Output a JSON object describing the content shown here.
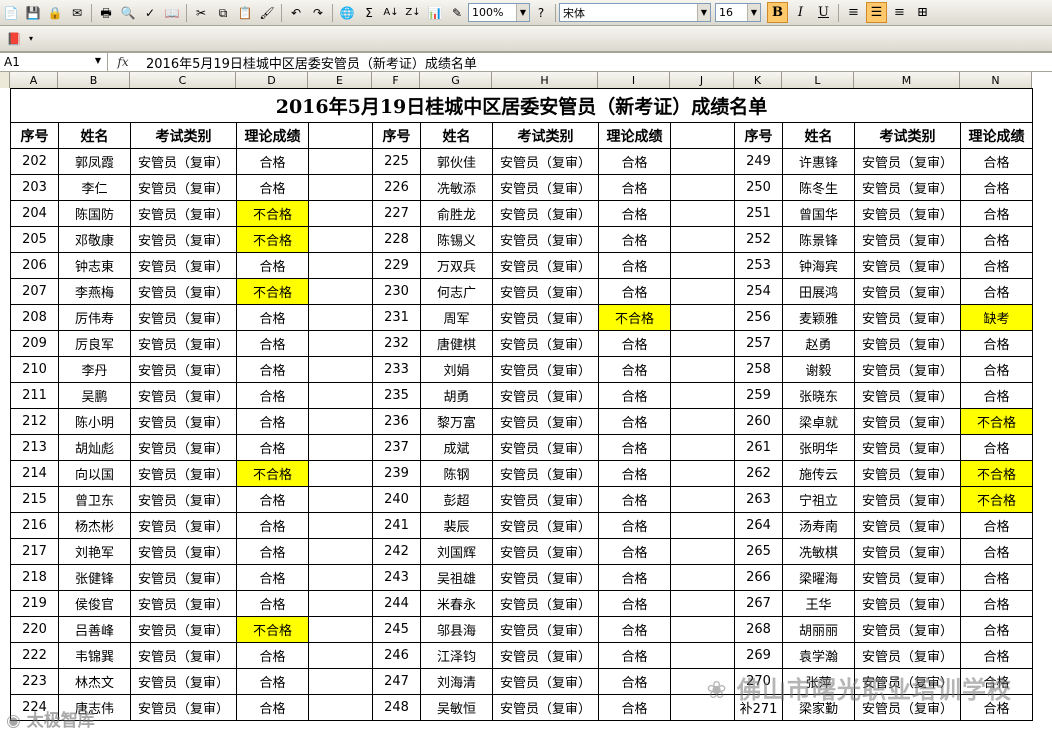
{
  "toolbar": {
    "zoom": "100%",
    "font": "宋体",
    "font_size": "16",
    "bold": "B",
    "italic": "I",
    "underline": "U",
    "sum": "Σ",
    "sort_asc": "A↓",
    "sort_desc": "Z↓"
  },
  "formula_bar": {
    "name_box": "A1",
    "fx": "fx",
    "content": "2016年5月19日桂城中区居委安管员（新考证）成绩名单"
  },
  "columns": [
    "A",
    "B",
    "C",
    "D",
    "E",
    "F",
    "G",
    "H",
    "I",
    "J",
    "K",
    "L",
    "M",
    "N"
  ],
  "sheet": {
    "title": "2016年5月19日桂城中区居委安管员（新考证）成绩名单",
    "headers": [
      "序号",
      "姓名",
      "考试类别",
      "理论成绩"
    ],
    "category": "安管员（复审）",
    "rows": [
      [
        [
          "202",
          "郭凤霞",
          "合格"
        ],
        [
          "225",
          "郭伙佳",
          "合格"
        ],
        [
          "249",
          "许惠锋",
          "合格"
        ]
      ],
      [
        [
          "203",
          "李仁",
          "合格"
        ],
        [
          "226",
          "冼敏添",
          "合格"
        ],
        [
          "250",
          "陈冬生",
          "合格"
        ]
      ],
      [
        [
          "204",
          "陈国防",
          "不合格"
        ],
        [
          "227",
          "俞胜龙",
          "合格"
        ],
        [
          "251",
          "曾国华",
          "合格"
        ]
      ],
      [
        [
          "205",
          "邓敬康",
          "不合格"
        ],
        [
          "228",
          "陈锡义",
          "合格"
        ],
        [
          "252",
          "陈景锋",
          "合格"
        ]
      ],
      [
        [
          "206",
          "钟志東",
          "合格"
        ],
        [
          "229",
          "万双兵",
          "合格"
        ],
        [
          "253",
          "钟海宾",
          "合格"
        ]
      ],
      [
        [
          "207",
          "李燕梅",
          "不合格"
        ],
        [
          "230",
          "何志广",
          "合格"
        ],
        [
          "254",
          "田展鸿",
          "合格"
        ]
      ],
      [
        [
          "208",
          "厉伟寿",
          "合格"
        ],
        [
          "231",
          "周军",
          "不合格"
        ],
        [
          "256",
          "麦颖雅",
          "缺考"
        ]
      ],
      [
        [
          "209",
          "厉良军",
          "合格"
        ],
        [
          "232",
          "唐健棋",
          "合格"
        ],
        [
          "257",
          "赵勇",
          "合格"
        ]
      ],
      [
        [
          "210",
          "李丹",
          "合格"
        ],
        [
          "233",
          "刘娟",
          "合格"
        ],
        [
          "258",
          "谢毅",
          "合格"
        ]
      ],
      [
        [
          "211",
          "吴鹏",
          "合格"
        ],
        [
          "235",
          "胡勇",
          "合格"
        ],
        [
          "259",
          "张晓东",
          "合格"
        ]
      ],
      [
        [
          "212",
          "陈小明",
          "合格"
        ],
        [
          "236",
          "黎万富",
          "合格"
        ],
        [
          "260",
          "梁卓就",
          "不合格"
        ]
      ],
      [
        [
          "213",
          "胡灿彪",
          "合格"
        ],
        [
          "237",
          "成斌",
          "合格"
        ],
        [
          "261",
          "张明华",
          "合格"
        ]
      ],
      [
        [
          "214",
          "向以国",
          "不合格"
        ],
        [
          "239",
          "陈钢",
          "合格"
        ],
        [
          "262",
          "施传云",
          "不合格"
        ]
      ],
      [
        [
          "215",
          "曾卫东",
          "合格"
        ],
        [
          "240",
          "彭超",
          "合格"
        ],
        [
          "263",
          "宁祖立",
          "不合格"
        ]
      ],
      [
        [
          "216",
          "杨杰彬",
          "合格"
        ],
        [
          "241",
          "裴辰",
          "合格"
        ],
        [
          "264",
          "汤寿南",
          "合格"
        ]
      ],
      [
        [
          "217",
          "刘艳军",
          "合格"
        ],
        [
          "242",
          "刘国辉",
          "合格"
        ],
        [
          "265",
          "冼敏棋",
          "合格"
        ]
      ],
      [
        [
          "218",
          "张健锋",
          "合格"
        ],
        [
          "243",
          "吴祖雄",
          "合格"
        ],
        [
          "266",
          "梁曜海",
          "合格"
        ]
      ],
      [
        [
          "219",
          "侯俊官",
          "合格"
        ],
        [
          "244",
          "米春永",
          "合格"
        ],
        [
          "267",
          "王华",
          "合格"
        ]
      ],
      [
        [
          "220",
          "吕善峰",
          "不合格"
        ],
        [
          "245",
          "邬县海",
          "合格"
        ],
        [
          "268",
          "胡丽丽",
          "合格"
        ]
      ],
      [
        [
          "222",
          "韦锦巽",
          "合格"
        ],
        [
          "246",
          "江泽钧",
          "合格"
        ],
        [
          "269",
          "袁学瀚",
          "合格"
        ]
      ],
      [
        [
          "223",
          "林杰文",
          "合格"
        ],
        [
          "247",
          "刘海清",
          "合格"
        ],
        [
          "270",
          "张萍",
          "合格"
        ]
      ],
      [
        [
          "224",
          "唐志伟",
          "合格"
        ],
        [
          "248",
          "吴敏恒",
          "合格"
        ],
        [
          "补271",
          "梁家勤",
          "合格"
        ]
      ]
    ]
  },
  "watermarks": {
    "school": "佛山市曙光职业培训学校",
    "brand": "太极智库"
  },
  "colors": {
    "fail_highlight": "#ffff00"
  }
}
